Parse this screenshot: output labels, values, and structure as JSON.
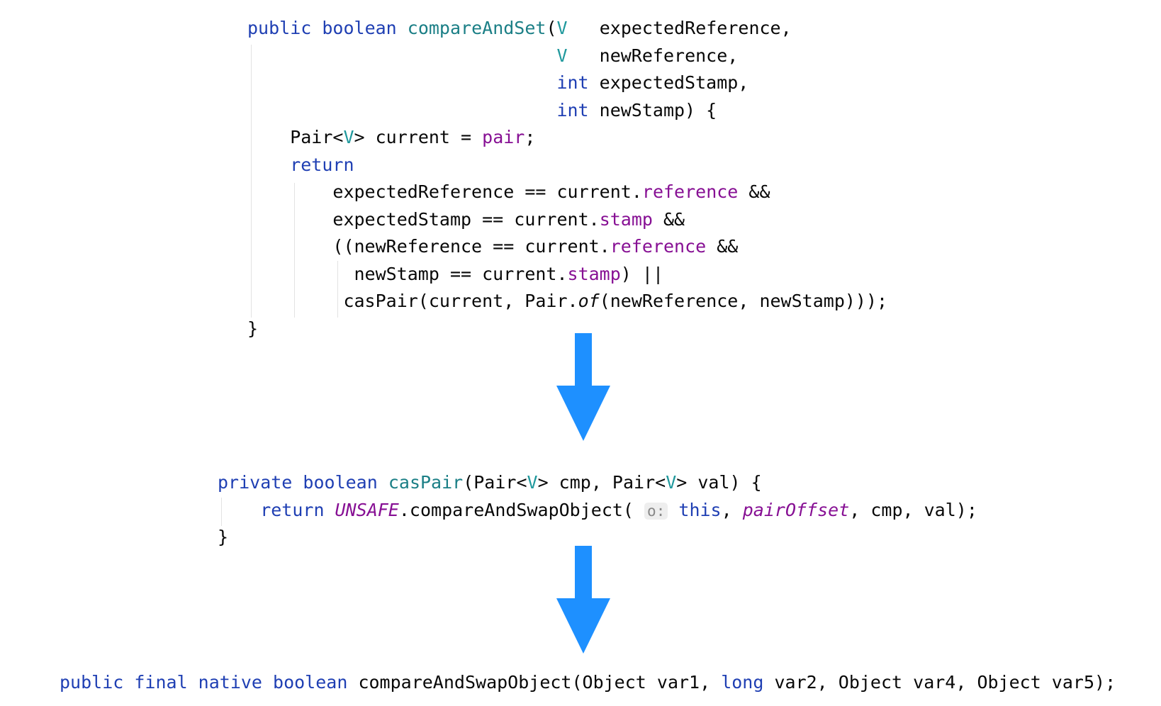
{
  "colors": {
    "keyword": "#1f3fb3",
    "method": "#1b7f86",
    "type_param": "#20999d",
    "field": "#871094",
    "arrow": "#1e90ff"
  },
  "blocks": [
    {
      "name": "compare-and-set-method",
      "lines": [
        {
          "indent": 0,
          "tokens": [
            [
              "public ",
              "kw"
            ],
            [
              "boolean ",
              "kw"
            ],
            [
              "compareAndSet",
              "fn"
            ],
            [
              "(",
              ""
            ],
            [
              "V",
              "tp"
            ],
            [
              "   expectedReference,",
              ""
            ]
          ]
        },
        {
          "indent": 29,
          "tokens": [
            [
              "V",
              "tp"
            ],
            [
              "   newReference,",
              ""
            ]
          ]
        },
        {
          "indent": 29,
          "tokens": [
            [
              "int",
              "kw"
            ],
            [
              " expectedStamp,",
              ""
            ]
          ]
        },
        {
          "indent": 29,
          "tokens": [
            [
              "int",
              "kw"
            ],
            [
              " newStamp) {",
              ""
            ]
          ]
        },
        {
          "indent": 4,
          "tokens": [
            [
              "Pair<",
              ""
            ],
            [
              "V",
              "tp"
            ],
            [
              "> current = ",
              ""
            ],
            [
              "pair",
              "fld"
            ],
            [
              ";",
              ""
            ]
          ]
        },
        {
          "indent": 4,
          "tokens": [
            [
              "return",
              "kw"
            ]
          ]
        },
        {
          "indent": 8,
          "tokens": [
            [
              "expectedReference == current.",
              ""
            ],
            [
              "reference",
              "fld"
            ],
            [
              " &&",
              ""
            ]
          ]
        },
        {
          "indent": 8,
          "tokens": [
            [
              "expectedStamp == current.",
              ""
            ],
            [
              "stamp",
              "fld"
            ],
            [
              " &&",
              ""
            ]
          ]
        },
        {
          "indent": 8,
          "tokens": [
            [
              "((newReference == current.",
              ""
            ],
            [
              "reference",
              "fld"
            ],
            [
              " &&",
              ""
            ]
          ]
        },
        {
          "indent": 10,
          "tokens": [
            [
              "newStamp == current.",
              ""
            ],
            [
              "stamp",
              "fld"
            ],
            [
              ") ||",
              ""
            ]
          ]
        },
        {
          "indent": 9,
          "tokens": [
            [
              "casPair(current, Pair.",
              ""
            ],
            [
              "of",
              "it"
            ],
            [
              "(newReference, newStamp)));",
              ""
            ]
          ]
        },
        {
          "indent": 0,
          "tokens": [
            [
              "}",
              ""
            ]
          ]
        }
      ]
    },
    {
      "name": "cas-pair-method",
      "lines": [
        {
          "indent": 0,
          "tokens": [
            [
              "private ",
              "kw"
            ],
            [
              "boolean ",
              "kw"
            ],
            [
              "casPair",
              "fn"
            ],
            [
              "(Pair<",
              ""
            ],
            [
              "V",
              "tp"
            ],
            [
              "> cmp, Pair<",
              ""
            ],
            [
              "V",
              "tp"
            ],
            [
              "> val) {",
              ""
            ]
          ]
        },
        {
          "indent": 4,
          "tokens": [
            [
              "return ",
              "kw"
            ],
            [
              "UNSAFE",
              "fld it"
            ],
            [
              ".compareAndSwapObject( ",
              ""
            ],
            [
              "o:",
              "hint"
            ],
            [
              " ",
              ""
            ],
            [
              "this",
              "kw"
            ],
            [
              ", ",
              ""
            ],
            [
              "pairOffset",
              "fld it"
            ],
            [
              ", cmp, val);",
              ""
            ]
          ]
        },
        {
          "indent": 0,
          "tokens": [
            [
              "}",
              ""
            ]
          ]
        }
      ]
    },
    {
      "name": "native-compare-and-swap-object",
      "lines": [
        {
          "indent": 0,
          "tokens": [
            [
              "public ",
              "kw"
            ],
            [
              "final ",
              "kw"
            ],
            [
              "native ",
              "kw"
            ],
            [
              "boolean ",
              "kw"
            ],
            [
              "compareAndSwapObject(Object var1, ",
              ""
            ],
            [
              "long",
              "kw"
            ],
            [
              " var2, Object var4, Object var5);",
              ""
            ]
          ]
        }
      ]
    }
  ],
  "arrows": [
    {
      "icon": "arrow-down-icon"
    },
    {
      "icon": "arrow-down-icon"
    }
  ]
}
